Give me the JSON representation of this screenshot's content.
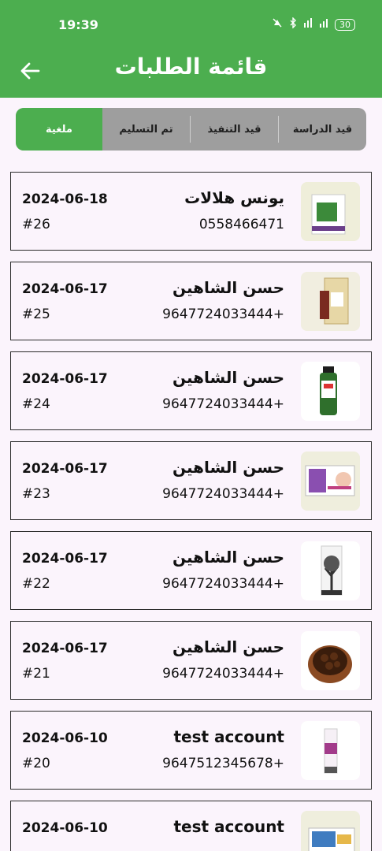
{
  "status_bar": {
    "time": "19:39",
    "battery": "30",
    "icons": [
      "mute-icon",
      "bluetooth-icon",
      "network-icon",
      "signal-icon",
      "battery-icon"
    ]
  },
  "appbar": {
    "title": "قائمة الطلبات",
    "back_icon": "back-arrow-icon"
  },
  "tabs": [
    {
      "label": "قيد الدراسة",
      "active": false
    },
    {
      "label": "قيد التنفيذ",
      "active": false
    },
    {
      "label": "تم التسليم",
      "active": false
    },
    {
      "label": "ملغية",
      "active": true
    }
  ],
  "orders": [
    {
      "name": "يونس هلالات",
      "phone": "0558466471",
      "date": "2024-06-18",
      "id": "#26",
      "thumb": "boxed-herbal-product"
    },
    {
      "name": "حسن الشاهين",
      "phone": "9647724033444+",
      "date": "2024-06-17",
      "id": "#25",
      "thumb": "beige-product-box"
    },
    {
      "name": "حسن الشاهين",
      "phone": "9647724033444+",
      "date": "2024-06-17",
      "id": "#24",
      "thumb": "green-bottle"
    },
    {
      "name": "حسن الشاهين",
      "phone": "9647724033444+",
      "date": "2024-06-17",
      "id": "#23",
      "thumb": "cosmetic-box"
    },
    {
      "name": "حسن الشاهين",
      "phone": "9647724033444+",
      "date": "2024-06-17",
      "id": "#22",
      "thumb": "tree-product-box"
    },
    {
      "name": "حسن الشاهين",
      "phone": "9647724033444+",
      "date": "2024-06-17",
      "id": "#21",
      "thumb": "seeds-bowl"
    },
    {
      "name": "test account",
      "phone": "9647512345678+",
      "date": "2024-06-10",
      "id": "#20",
      "thumb": "tall-slim-box"
    },
    {
      "name": "test account",
      "phone": "",
      "date": "2024-06-10",
      "id": "",
      "thumb": "boxed-product"
    }
  ],
  "colors": {
    "primary": "#4cae4f",
    "tab_inactive": "#9e9e9e",
    "background": "#fbf4fc"
  }
}
